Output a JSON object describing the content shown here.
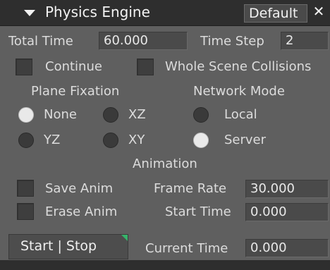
{
  "header": {
    "title": "Physics Engine",
    "preset": "Default",
    "close": "✕"
  },
  "time": {
    "total_label": "Total Time",
    "total_value": "60.000",
    "step_label": "Time Step",
    "step_value": "2"
  },
  "options": {
    "continue_label": "Continue",
    "whole_scene_label": "Whole Scene Collisions"
  },
  "plane_fixation": {
    "heading": "Plane Fixation",
    "none": "None",
    "xz": "XZ",
    "yz": "YZ",
    "xy": "XY",
    "selected": "None"
  },
  "network_mode": {
    "heading": "Network Mode",
    "local": "Local",
    "server": "Server",
    "selected": "Server"
  },
  "animation": {
    "heading": "Animation",
    "save_label": "Save Anim",
    "erase_label": "Erase Anim",
    "frame_rate_label": "Frame Rate",
    "frame_rate_value": "30.000",
    "start_time_label": "Start Time",
    "start_time_value": "0.000",
    "current_time_label": "Current Time",
    "current_time_value": "0.000"
  },
  "controls": {
    "start_stop_label": "Start | Stop"
  }
}
